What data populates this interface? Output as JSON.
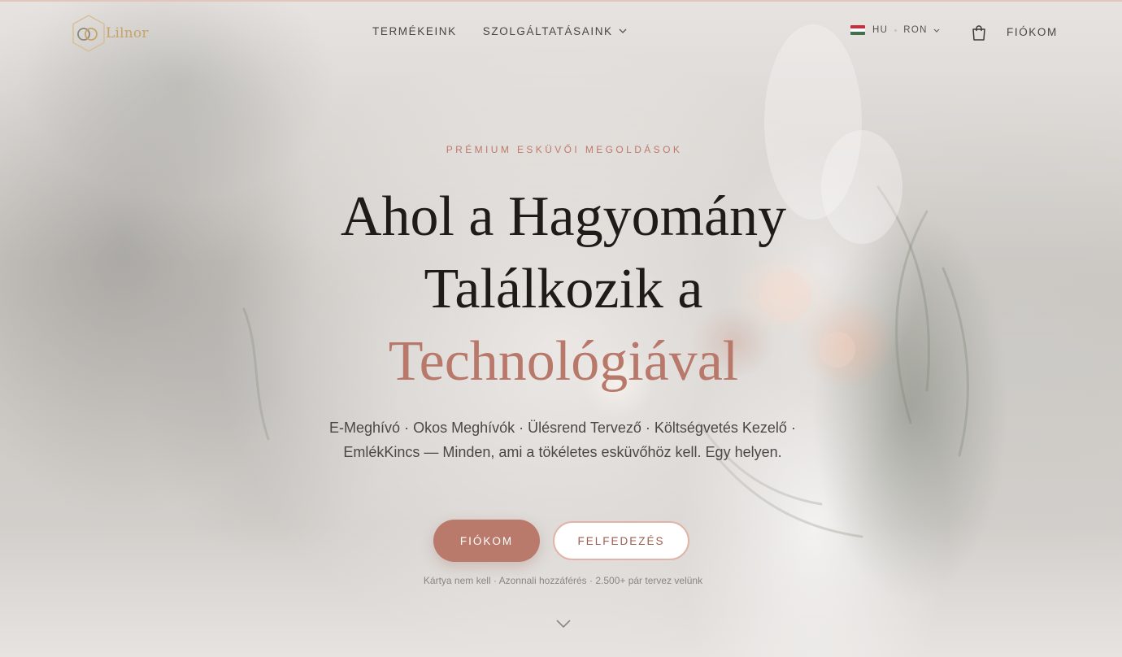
{
  "header": {
    "logo_text": "Lilnor",
    "nav": {
      "products_label": "TERMÉKEINK",
      "services_label": "SZOLGÁLTATÁSAINK"
    },
    "language": "HU",
    "currency": "RON",
    "account_label": "FIÓKOM"
  },
  "hero": {
    "eyebrow": "PRÉMIUM ESKÜVŐI MEGOLDÁSOK",
    "headline_line1": "Ahol a Hagyomány",
    "headline_line2": "Találkozik a",
    "headline_accent": "Technológiával",
    "subtitle": "E-Meghívó · Okos Meghívók · Ülésrend Tervező · Költségvetés Kezelő · EmlékKincs — Minden, ami a tökéletes esküvőhöz kell. Egy helyen.",
    "primary_cta": "FIÓKOM",
    "secondary_cta": "FELFEDEZÉS",
    "trust_line": "Kártya nem kell · Azonnali hozzáférés · 2.500+ pár tervez velünk"
  },
  "icons": {
    "logo": "interlocked-rings-hexagon-icon",
    "flag": "hungary-flag-icon",
    "dropdown": "chevron-down-icon",
    "cart": "shopping-bag-icon",
    "scroll": "chevron-down-icon"
  },
  "colors": {
    "accent": "#b97a6c",
    "accent_light": "#e2b4a8",
    "eyebrow": "#c0796a",
    "logo_gold": "#c8a36b",
    "headline": "#1f1b19",
    "flag_red": "#cd2a3e",
    "flag_white": "#ffffff",
    "flag_green": "#436f4d"
  }
}
